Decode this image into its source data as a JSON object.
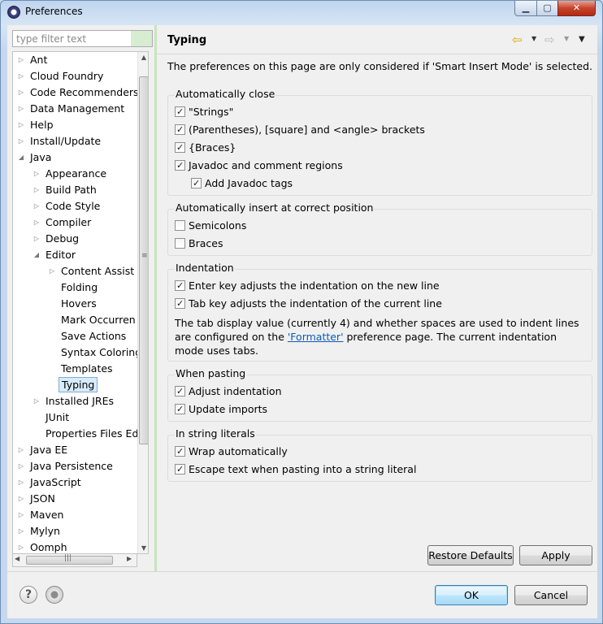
{
  "window": {
    "title": "Preferences"
  },
  "filter": {
    "placeholder": "type filter text"
  },
  "tree": {
    "items": [
      {
        "label": "Ant"
      },
      {
        "label": "Cloud Foundry"
      },
      {
        "label": "Code Recommenders"
      },
      {
        "label": "Data Management"
      },
      {
        "label": "Help"
      },
      {
        "label": "Install/Update"
      },
      {
        "label": "Java"
      },
      {
        "label": "Appearance"
      },
      {
        "label": "Build Path"
      },
      {
        "label": "Code Style"
      },
      {
        "label": "Compiler"
      },
      {
        "label": "Debug"
      },
      {
        "label": "Editor"
      },
      {
        "label": "Content Assist"
      },
      {
        "label": "Folding"
      },
      {
        "label": "Hovers"
      },
      {
        "label": "Mark Occurren"
      },
      {
        "label": "Save Actions"
      },
      {
        "label": "Syntax Coloring"
      },
      {
        "label": "Templates"
      },
      {
        "label": "Typing"
      },
      {
        "label": "Installed JREs"
      },
      {
        "label": "JUnit"
      },
      {
        "label": "Properties Files Ed"
      },
      {
        "label": "Java EE"
      },
      {
        "label": "Java Persistence"
      },
      {
        "label": "JavaScript"
      },
      {
        "label": "JSON"
      },
      {
        "label": "Maven"
      },
      {
        "label": "Mylyn"
      },
      {
        "label": "Oomph"
      }
    ]
  },
  "page": {
    "title": "Typing",
    "description": "The preferences on this page are only considered if 'Smart Insert Mode' is selected."
  },
  "groups": {
    "auto_close": {
      "label": "Automatically close",
      "options": [
        {
          "label": "\"Strings\"",
          "checked": true
        },
        {
          "label": "(Parentheses), [square] and <angle> brackets",
          "checked": true
        },
        {
          "label": "{Braces}",
          "checked": true
        },
        {
          "label": "Javadoc and comment regions",
          "checked": true
        },
        {
          "label": "Add Javadoc tags",
          "checked": true
        }
      ]
    },
    "auto_insert": {
      "label": "Automatically insert at correct position",
      "options": [
        {
          "label": "Semicolons",
          "checked": false
        },
        {
          "label": "Braces",
          "checked": false
        }
      ]
    },
    "indentation": {
      "label": "Indentation",
      "options": [
        {
          "label": "Enter key adjusts the indentation on the new line",
          "checked": true
        },
        {
          "label": "Tab key adjusts the indentation of the current line",
          "checked": true
        }
      ],
      "info_before": "The tab display value (currently 4) and whether spaces are used to indent lines are configured on the ",
      "info_link": "'Formatter'",
      "info_after": " preference page. The current indentation mode uses tabs."
    },
    "pasting": {
      "label": "When pasting",
      "options": [
        {
          "label": "Adjust indentation",
          "checked": true
        },
        {
          "label": "Update imports",
          "checked": true
        }
      ]
    },
    "string_literals": {
      "label": "In string literals",
      "options": [
        {
          "label": "Wrap automatically",
          "checked": true
        },
        {
          "label": "Escape text when pasting into a string literal",
          "checked": true
        }
      ]
    }
  },
  "buttons": {
    "restore_defaults": "Restore Defaults",
    "apply": "Apply",
    "ok": "OK",
    "cancel": "Cancel"
  },
  "icons": {
    "app": "eclipse-icon",
    "back": "back-arrow-icon",
    "forward": "forward-arrow-icon",
    "help": "help-icon",
    "record": "record-icon"
  }
}
